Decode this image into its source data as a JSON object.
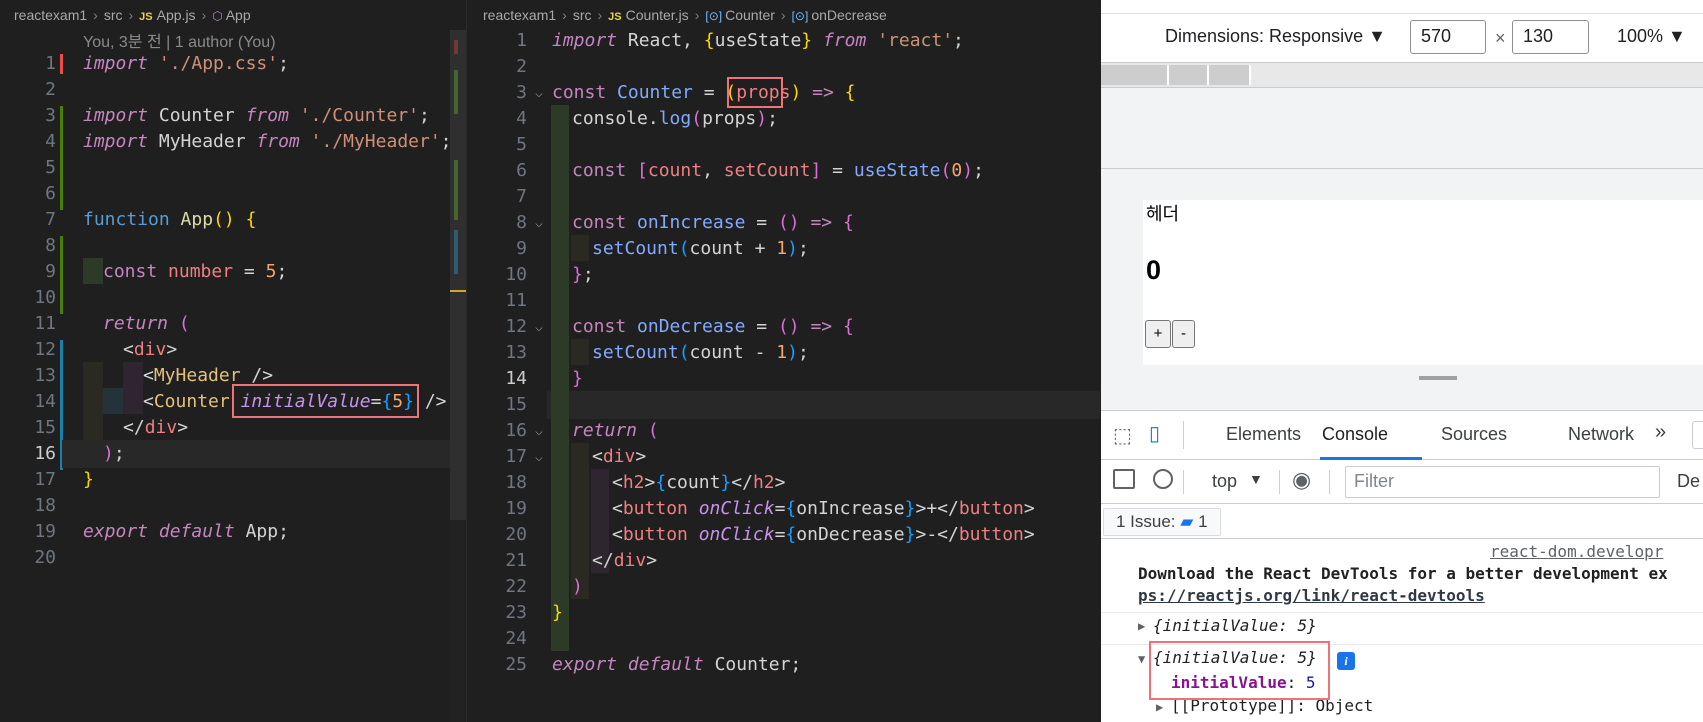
{
  "editor1": {
    "breadcrumb": [
      "reactexam1",
      "src",
      "App.js",
      "App"
    ],
    "codelens": "You, 3분 전 | 1 author (You)",
    "lines": [
      "1",
      "2",
      "3",
      "4",
      "5",
      "6",
      "7",
      "8",
      "9",
      "10",
      "11",
      "12",
      "13",
      "14",
      "15",
      "16",
      "17",
      "18",
      "19",
      "20"
    ]
  },
  "editor2": {
    "breadcrumb": [
      "reactexam1",
      "src",
      "Counter.js",
      "Counter",
      "onDecrease"
    ],
    "lines": [
      "1",
      "2",
      "3",
      "4",
      "5",
      "6",
      "7",
      "8",
      "9",
      "10",
      "11",
      "12",
      "13",
      "14",
      "15",
      "16",
      "17",
      "18",
      "19",
      "20",
      "21",
      "22",
      "23",
      "24",
      "25"
    ]
  },
  "devtools": {
    "dimensions_label": "Dimensions: Responsive ▼",
    "width": "570",
    "times": "×",
    "height": "130",
    "zoom": "100% ▼",
    "preview": {
      "header": "헤더",
      "count": "0",
      "plus": "+",
      "minus": "-"
    },
    "tabs": [
      "Elements",
      "Console",
      "Sources",
      "Network",
      "»"
    ],
    "active_tab": "Console",
    "context": "top",
    "filter_placeholder": "Filter",
    "default_levels": "De",
    "issues_label": "1 Issue:",
    "issues_count": "1",
    "console": {
      "source_link": "react-dom.developr",
      "devtools_msg": "Download the React DevTools for a better development ex",
      "devtools_link": "ps://reactjs.org/link/react-devtools",
      "log1": "{initialValue: 5}",
      "log2": "{initialValue: 5}",
      "prop_key": "initialValue",
      "prop_val": "5",
      "prototype": "[[Prototype]]: Object"
    }
  }
}
